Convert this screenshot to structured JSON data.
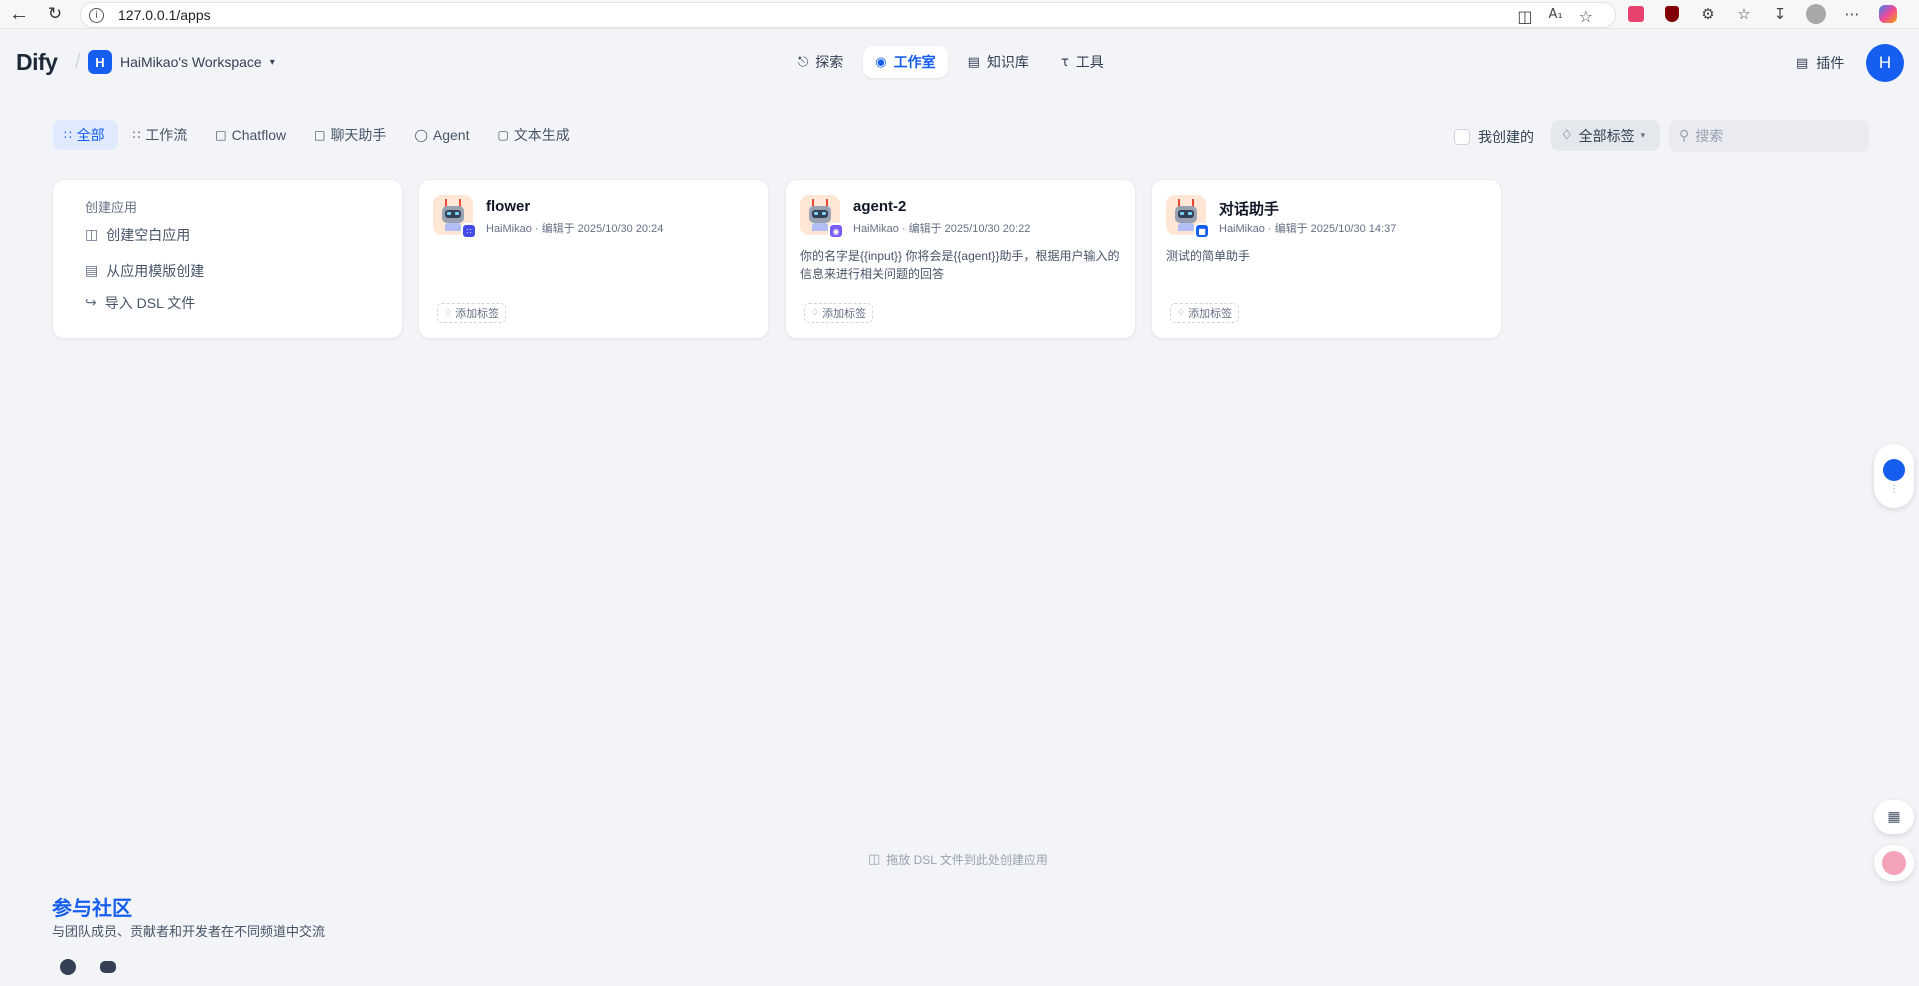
{
  "browser": {
    "url": "127.0.0.1/apps",
    "back_icon": "arrow-left-icon",
    "refresh_icon": "refresh-icon"
  },
  "header": {
    "logo": "Dify",
    "workspace_initial": "H",
    "workspace_name": "HaiMikao's Workspace",
    "nav": [
      {
        "label": "探索",
        "icon": "explore-icon"
      },
      {
        "label": "工作室",
        "icon": "robot-icon",
        "active": true
      },
      {
        "label": "知识库",
        "icon": "book-icon"
      },
      {
        "label": "工具",
        "icon": "hammer-icon"
      }
    ],
    "plugin_label": "插件",
    "avatar_initial": "H"
  },
  "filters": {
    "tabs": [
      {
        "label": "全部",
        "active": true
      },
      {
        "label": "工作流"
      },
      {
        "label": "Chatflow"
      },
      {
        "label": "聊天助手"
      },
      {
        "label": "Agent"
      },
      {
        "label": "文本生成"
      }
    ],
    "mine_label": "我创建的",
    "tag_select_label": "全部标签",
    "search_placeholder": "搜索"
  },
  "create_card": {
    "title": "创建应用",
    "items": [
      "创建空白应用",
      "从应用模版创建",
      "导入 DSL 文件"
    ]
  },
  "apps": [
    {
      "name": "flower",
      "meta": "HaiMikao · 编辑于 2025/10/30 20:24",
      "description": "",
      "add_tag": "添加标签",
      "badge_color": "#444ce7",
      "badge_icon": "workflow-icon"
    },
    {
      "name": "agent-2",
      "meta": "HaiMikao · 编辑于 2025/10/30 20:22",
      "description": "你的名字是{{input}} 你将会是{{agent}}助手，根据用户输入的信息来进行相关问题的回答",
      "add_tag": "添加标签",
      "badge_color": "#7a5af8",
      "badge_icon": "agent-icon"
    },
    {
      "name": "对话助手",
      "meta": "HaiMikao · 编辑于 2025/10/30 14:37",
      "description": "测试的简单助手",
      "add_tag": "添加标签",
      "badge_color": "#155eef",
      "badge_icon": "chat-icon"
    }
  ],
  "drop_hint": "拖放 DSL 文件到此处创建应用",
  "community": {
    "title": "参与社区",
    "description": "与团队成员、贡献者和开发者在不同频道中交流"
  }
}
